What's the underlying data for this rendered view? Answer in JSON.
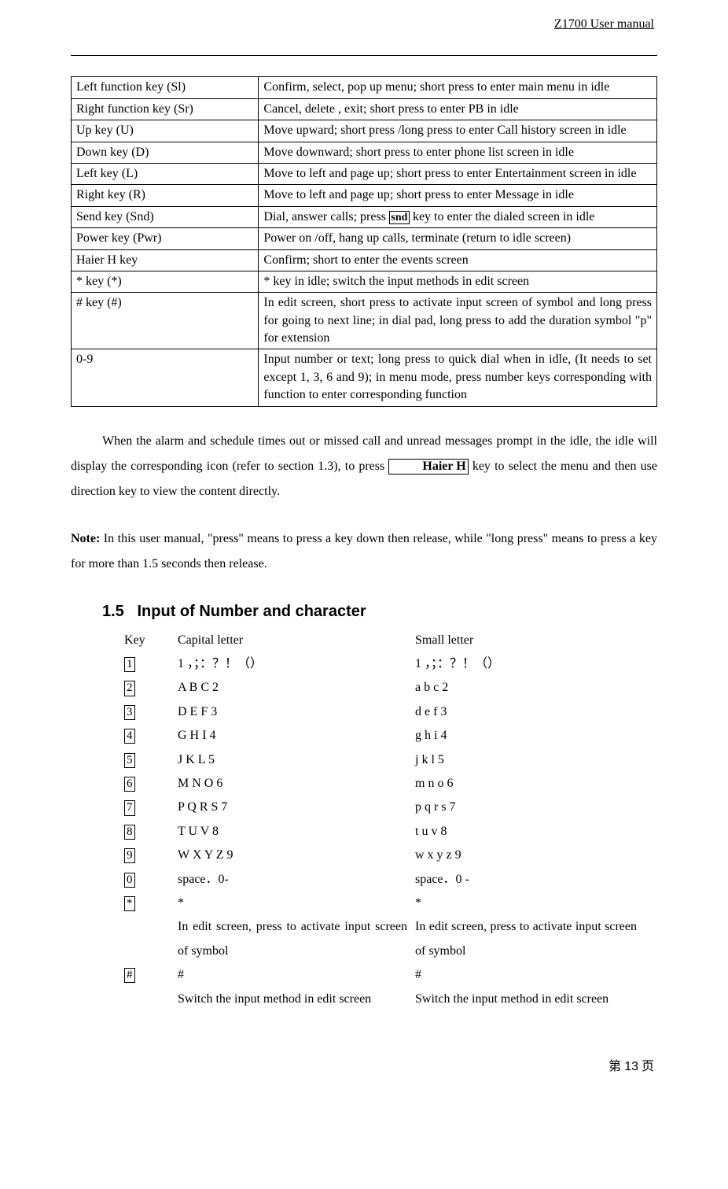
{
  "header": {
    "title": "Z1700 User manual"
  },
  "keytable": [
    {
      "key": "Left function key (Sl)",
      "desc": "Confirm, select, pop up menu; short press to enter main menu in idle"
    },
    {
      "key": "Right function key (Sr)",
      "desc": "Cancel, delete , exit; short press to enter PB in idle"
    },
    {
      "key": "Up key (U)",
      "desc": "Move upward; short press /long press to enter Call history screen in idle"
    },
    {
      "key": "Down key (D)",
      "desc": "Move downward; short press to enter phone list screen in idle"
    },
    {
      "key": "Left key (L)",
      "desc": "Move to left and page up; short press to enter Entertainment screen in idle"
    },
    {
      "key": "Right key (R)",
      "desc": "Move to left and page up; short press to enter Message in idle"
    },
    {
      "key": "Send key (Snd)",
      "desc_pre": "Dial, answer calls; press ",
      "desc_key": "snd",
      "desc_post": " key to enter the dialed screen in idle"
    },
    {
      "key": "Power key (Pwr)",
      "desc": "Power on /off, hang up calls, terminate (return to idle screen)"
    },
    {
      "key": "Haier H key",
      "desc": "Confirm; short to enter the events screen"
    },
    {
      "key": "* key (*)",
      "desc": "* key in idle; switch the input methods in edit screen"
    },
    {
      "key": "# key (#)",
      "desc": "In edit screen, short press to activate input screen of symbol and long press for going to next line; in dial pad, long press to add the duration symbol \"p\" for extension"
    },
    {
      "key": "0-9",
      "desc": "Input number or text; long press to quick dial when in idle, (It needs to set except 1, 3, 6 and 9); in menu mode, press number keys corresponding with function to enter corresponding function"
    }
  ],
  "para1": {
    "pre": "When the alarm and schedule times out or missed call and unread messages prompt in the idle, the idle will display the corresponding icon (refer to section 1.3), to press ",
    "key": "Haier H",
    "post": " key to select the menu and then use direction key to view the content directly."
  },
  "note": {
    "label": "Note:",
    "text": " In this user manual, \"press\" means to press a key down then release, while \"long press\" means to press a key for more than 1.5 seconds then release."
  },
  "section": {
    "num": "1.5",
    "title": "Input of Number and character"
  },
  "inputHeader": {
    "key": "Key",
    "cap": "Capital letter",
    "sml": "Small letter"
  },
  "inputRows": [
    {
      "k": "1",
      "cap": "1 ，；：？！（）",
      "sml": "1 ，；：？！（）"
    },
    {
      "k": "2",
      "cap": "A B C 2",
      "sml": "a b c 2"
    },
    {
      "k": "3",
      "cap": "D E F 3",
      "sml": "d e f 3"
    },
    {
      "k": "4",
      "cap": "G H I 4",
      "sml": "g h i 4"
    },
    {
      "k": "5",
      "cap": "J K L 5",
      "sml": "j k l 5"
    },
    {
      "k": "6",
      "cap": "M N O 6",
      "sml": "m n o 6"
    },
    {
      "k": "7",
      "cap": "P Q R S 7",
      "sml": "p q r s 7"
    },
    {
      "k": "8",
      "cap": "T U V 8",
      "sml": "t u v 8"
    },
    {
      "k": "9",
      "cap": "W X Y Z 9",
      "sml": "w x y z 9"
    },
    {
      "k": "0",
      "cap": "space．0-",
      "sml": "space．0 -"
    },
    {
      "k": "*",
      "cap": "*",
      "sml": "*",
      "cap2": "In edit screen, press to activate input screen of symbol",
      "sml2": "In edit screen, press to activate input screen of symbol"
    },
    {
      "k": "#",
      "cap": "#",
      "sml": "#",
      "cap2": "Switch the input method in edit screen",
      "sml2": "Switch the input method in edit screen"
    }
  ],
  "footer": {
    "pre": "第 ",
    "num": "13",
    "post": " 页"
  }
}
